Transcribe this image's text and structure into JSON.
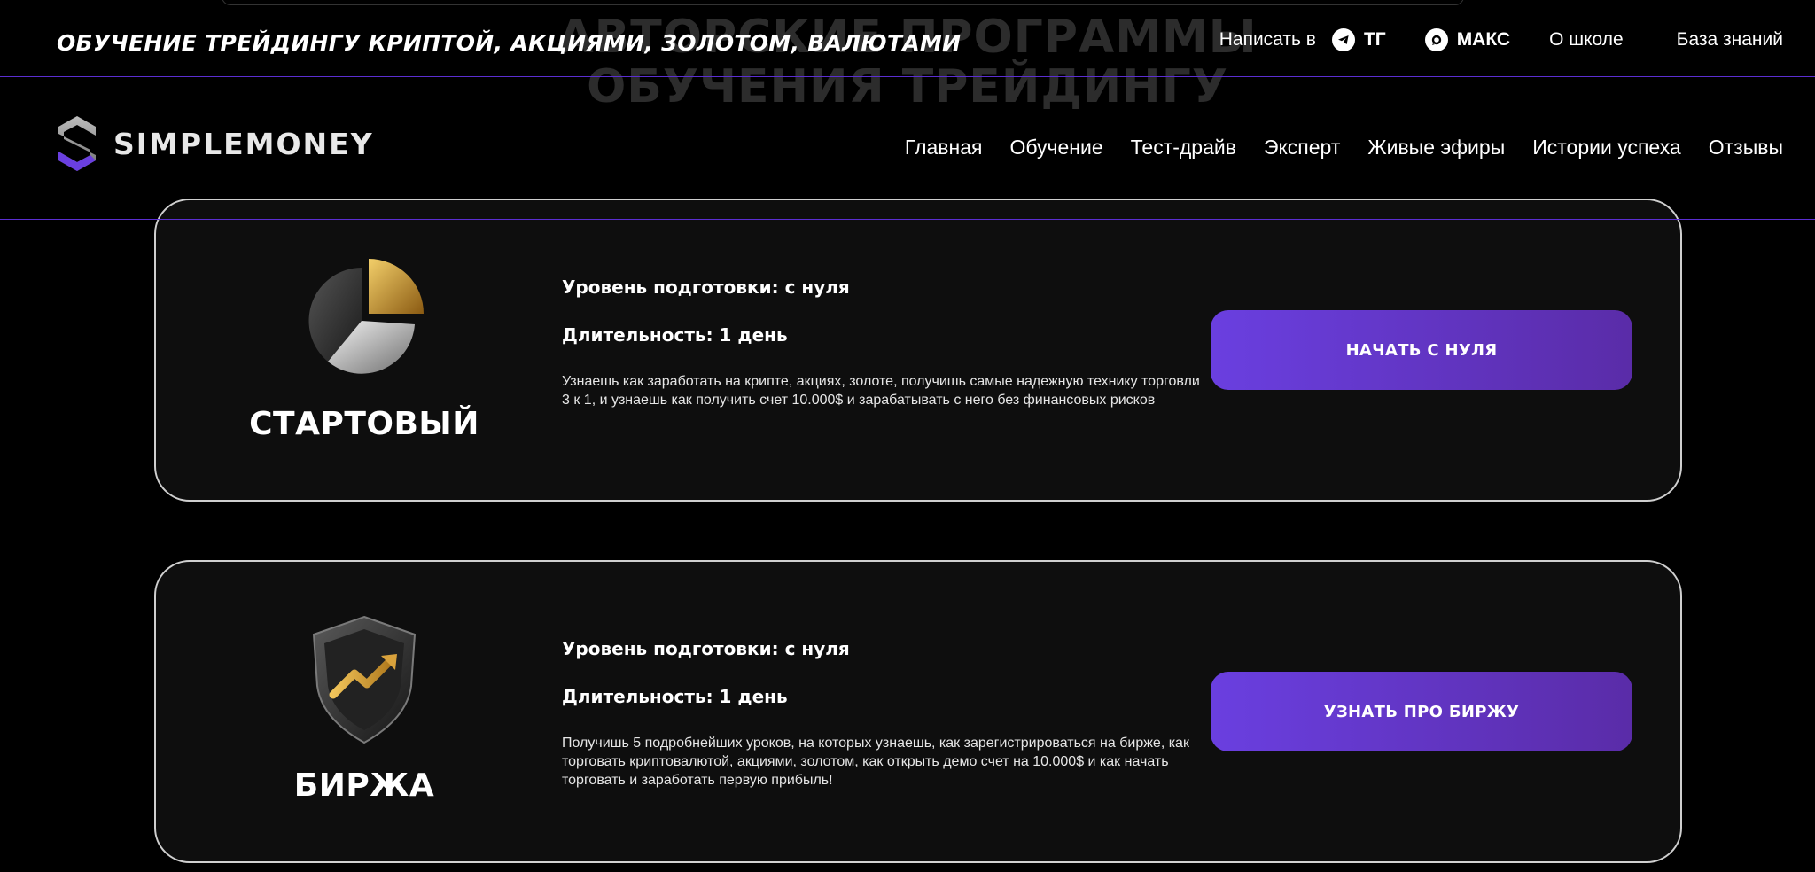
{
  "background_heading": {
    "line1": "АВТОРСКИЕ ПРОГРАММЫ",
    "line2": "ОБУЧЕНИЯ ТРЕЙДИНГУ"
  },
  "topbar": {
    "tagline": "ОБУЧЕНИЕ ТРЕЙДИНГУ КРИПТОЙ, АКЦИЯМИ, ЗОЛОТОМ, ВАЛЮТАМИ",
    "write_label": "Написать в",
    "telegram_label": "ТГ",
    "max_label": "МАКС",
    "about_label": "О школе",
    "knowledge_label": "База знаний"
  },
  "header": {
    "brand": "SIMPLEMONEY",
    "nav": [
      "Главная",
      "Обучение",
      "Тест-драйв",
      "Эксперт",
      "Живые эфиры",
      "Истории успеха",
      "Отзывы"
    ]
  },
  "cards": [
    {
      "name": "СТАРТОВЫЙ",
      "level": "Уровень подготовки: с нуля",
      "duration": "Длительность: 1 день",
      "description": "Узнаешь как заработать на крипте, акциях, золоте, получишь самые надежную технику торговли 3 к 1, и узнаешь как получить счет 10.000$ и зарабатывать с него без финансовых рисков",
      "button": "НАЧАТЬ С НУЛЯ"
    },
    {
      "name": "БИРЖА",
      "level": "Уровень подготовки: с нуля",
      "duration": "Длительность: 1 день",
      "description": "Получишь 5 подробнейших уроков, на которых узнаешь, как зарегистрироваться на бирже, как торговать криптовалютой, акциями, золотом, как открыть демо счет на 10.000$ и как начать торговать и заработать первую прибыль!",
      "button": "УЗНАТЬ ПРО БИРЖУ"
    }
  ],
  "colors": {
    "accent": "#6a3fe0",
    "divider": "#5b2ed1",
    "card_border": "#cfcfcf",
    "gold": "#d4a23a"
  }
}
